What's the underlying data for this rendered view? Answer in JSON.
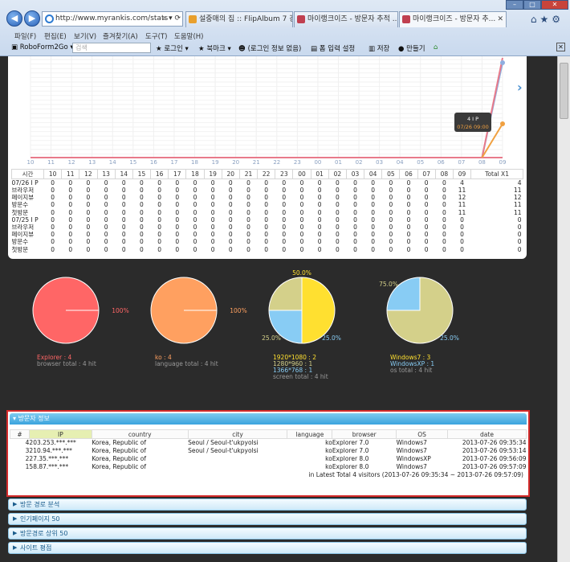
{
  "browser": {
    "address": "http://www.myrankis.com/stats",
    "tabs": [
      {
        "label": "설중매의 집 :: FlipAlbum 7 강..."
      },
      {
        "label": "마이랭크이즈 - 방문자 추적 ..."
      },
      {
        "label": "마이랭크이즈 - 방문자 추..."
      }
    ],
    "menu": [
      "파일(F)",
      "편집(E)",
      "보기(V)",
      "즐겨찾기(A)",
      "도구(T)",
      "도움말(H)"
    ],
    "toolbar": {
      "roboform": "RoboForm2Go",
      "search_placeholder": "검색",
      "login": "로그인",
      "bookmark": "북마크",
      "login_info": "(로그인 정보 없음)",
      "form_settings": "폼 입력 설정",
      "save": "저장",
      "make": "만들기"
    }
  },
  "hourly_chart": {
    "x_labels": [
      "10",
      "11",
      "12",
      "13",
      "14",
      "15",
      "16",
      "17",
      "18",
      "19",
      "20",
      "21",
      "22",
      "23",
      "00",
      "01",
      "02",
      "03",
      "04",
      "05",
      "06",
      "07",
      "08",
      "09"
    ],
    "tooltip_title": "4 I P",
    "tooltip_sub": "07/26 09:00",
    "colors": {
      "ip": "#e87a8a",
      "browser": "#f0a040",
      "page": "#8faee0"
    }
  },
  "hourly_table": {
    "headers": [
      "시간",
      "10",
      "11",
      "12",
      "13",
      "14",
      "15",
      "16",
      "17",
      "18",
      "19",
      "20",
      "21",
      "22",
      "23",
      "00",
      "01",
      "02",
      "03",
      "04",
      "05",
      "06",
      "07",
      "08",
      "09",
      "Total X1"
    ],
    "rows": [
      {
        "label": "07/26 I P",
        "values": [
          "0",
          "0",
          "0",
          "0",
          "0",
          "0",
          "0",
          "0",
          "0",
          "0",
          "0",
          "0",
          "0",
          "0",
          "0",
          "0",
          "0",
          "0",
          "0",
          "0",
          "0",
          "0",
          "0",
          "4",
          "4"
        ]
      },
      {
        "label": "브라우저",
        "values": [
          "0",
          "0",
          "0",
          "0",
          "0",
          "0",
          "0",
          "0",
          "0",
          "0",
          "0",
          "0",
          "0",
          "0",
          "0",
          "0",
          "0",
          "0",
          "0",
          "0",
          "0",
          "0",
          "0",
          "11",
          "11"
        ]
      },
      {
        "label": "페이지뷰",
        "values": [
          "0",
          "0",
          "0",
          "0",
          "0",
          "0",
          "0",
          "0",
          "0",
          "0",
          "0",
          "0",
          "0",
          "0",
          "0",
          "0",
          "0",
          "0",
          "0",
          "0",
          "0",
          "0",
          "0",
          "12",
          "12"
        ]
      },
      {
        "label": "방문수",
        "values": [
          "0",
          "0",
          "0",
          "0",
          "0",
          "0",
          "0",
          "0",
          "0",
          "0",
          "0",
          "0",
          "0",
          "0",
          "0",
          "0",
          "0",
          "0",
          "0",
          "0",
          "0",
          "0",
          "0",
          "11",
          "11"
        ]
      },
      {
        "label": "첫방문",
        "values": [
          "0",
          "0",
          "0",
          "0",
          "0",
          "0",
          "0",
          "0",
          "0",
          "0",
          "0",
          "0",
          "0",
          "0",
          "0",
          "0",
          "0",
          "0",
          "0",
          "0",
          "0",
          "0",
          "0",
          "11",
          "11"
        ]
      },
      {
        "label": "07/25 I P",
        "values": [
          "0",
          "0",
          "0",
          "0",
          "0",
          "0",
          "0",
          "0",
          "0",
          "0",
          "0",
          "0",
          "0",
          "0",
          "0",
          "0",
          "0",
          "0",
          "0",
          "0",
          "0",
          "0",
          "0",
          "0",
          "0"
        ]
      },
      {
        "label": "브라우저",
        "values": [
          "0",
          "0",
          "0",
          "0",
          "0",
          "0",
          "0",
          "0",
          "0",
          "0",
          "0",
          "0",
          "0",
          "0",
          "0",
          "0",
          "0",
          "0",
          "0",
          "0",
          "0",
          "0",
          "0",
          "0",
          "0"
        ]
      },
      {
        "label": "페이지뷰",
        "values": [
          "0",
          "0",
          "0",
          "0",
          "0",
          "0",
          "0",
          "0",
          "0",
          "0",
          "0",
          "0",
          "0",
          "0",
          "0",
          "0",
          "0",
          "0",
          "0",
          "0",
          "0",
          "0",
          "0",
          "0",
          "0"
        ]
      },
      {
        "label": "방문수",
        "values": [
          "0",
          "0",
          "0",
          "0",
          "0",
          "0",
          "0",
          "0",
          "0",
          "0",
          "0",
          "0",
          "0",
          "0",
          "0",
          "0",
          "0",
          "0",
          "0",
          "0",
          "0",
          "0",
          "0",
          "0",
          "0"
        ]
      },
      {
        "label": "첫방문",
        "values": [
          "0",
          "0",
          "0",
          "0",
          "0",
          "0",
          "0",
          "0",
          "0",
          "0",
          "0",
          "0",
          "0",
          "0",
          "0",
          "0",
          "0",
          "0",
          "0",
          "0",
          "0",
          "0",
          "0",
          "0",
          "0"
        ]
      }
    ]
  },
  "pies": [
    {
      "labels": [
        {
          "text": "100%"
        }
      ],
      "legend": [
        {
          "text": "Explorer : 4",
          "color": "#ff6666"
        },
        {
          "text": "browser total : 4 hit",
          "color": "#999999"
        }
      ],
      "slices": [
        {
          "value": 100,
          "color": "#ff6666"
        }
      ]
    },
    {
      "labels": [
        {
          "text": "100%"
        }
      ],
      "legend": [
        {
          "text": "ko : 4",
          "color": "#ffa060"
        },
        {
          "text": "language total : 4 hit",
          "color": "#999999"
        }
      ],
      "slices": [
        {
          "value": 100,
          "color": "#ffa060"
        }
      ]
    },
    {
      "labels": [
        {
          "text": "50.0%"
        },
        {
          "text": "25.0%"
        },
        {
          "text": "25.0%"
        }
      ],
      "legend": [
        {
          "text": "1920*1080 : 2",
          "color": "#ffe030"
        },
        {
          "text": "1280*960 : 1",
          "color": "#d4d08a"
        },
        {
          "text": "1366*768 : 1",
          "color": "#88ccf4"
        },
        {
          "text": "screen total : 4 hit",
          "color": "#999999"
        }
      ],
      "slices": [
        {
          "value": 50,
          "color": "#ffe030"
        },
        {
          "value": 25,
          "color": "#88ccf4"
        },
        {
          "value": 25,
          "color": "#d4d08a"
        }
      ]
    },
    {
      "labels": [
        {
          "text": "75.0%"
        },
        {
          "text": "25.0%"
        }
      ],
      "legend": [
        {
          "text": "Windows7 : 3",
          "color": "#ffe030"
        },
        {
          "text": "WindowsXP : 1",
          "color": "#88ccf4"
        },
        {
          "text": "os total : 4 hit",
          "color": "#999999"
        }
      ],
      "slices": [
        {
          "value": 75,
          "color": "#d4d08a"
        },
        {
          "value": 25,
          "color": "#88ccf4"
        }
      ]
    }
  ],
  "visitors": {
    "title": "방문자 정보",
    "headers": [
      "#",
      "IP",
      "country",
      "city",
      "language",
      "browser",
      "OS",
      "date"
    ],
    "rows": [
      {
        "n": "4",
        "ip": "203.253.***.***",
        "country": "Korea, Republic of",
        "city": "Seoul / Seoul-t'ukpyolsi",
        "lang": "ko",
        "browser": "Explorer 7.0",
        "os": "Windows7",
        "date": "2013-07-26 09:35:34"
      },
      {
        "n": "3",
        "ip": "210.94.***.***",
        "country": "Korea, Republic of",
        "city": "Seoul / Seoul-t'ukpyolsi",
        "lang": "ko",
        "browser": "Explorer 7.0",
        "os": "Windows7",
        "date": "2013-07-26 09:53:14"
      },
      {
        "n": "2",
        "ip": "27.35.***.***",
        "country": "Korea, Republic of",
        "city": "",
        "lang": "ko",
        "browser": "Explorer 8.0",
        "os": "WindowsXP",
        "date": "2013-07-26 09:56:09"
      },
      {
        "n": "1",
        "ip": "58.87.***.***",
        "country": "Korea, Republic of",
        "city": "",
        "lang": "ko",
        "browser": "Explorer 8.0",
        "os": "Windows7",
        "date": "2013-07-26 09:57:09"
      }
    ],
    "footer": "in Latest Total 4 visitors (2013-07-26 09:35:34 ~ 2013-07-26 09:57:09)"
  },
  "sections": [
    "방문 경로 분석",
    "인기페이지 50",
    "방문경로 상위 50",
    "사이트 평점"
  ]
}
